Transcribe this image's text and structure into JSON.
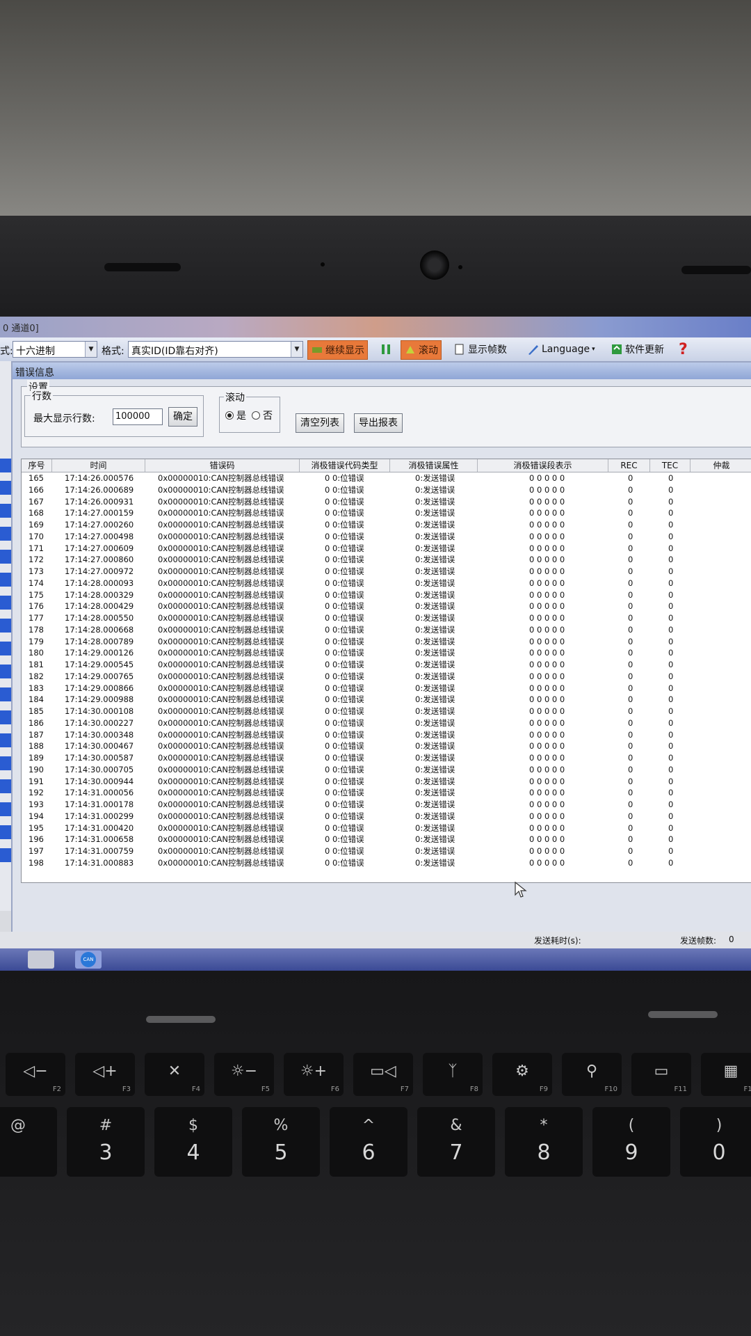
{
  "titlebar": {
    "text": "0 通道0]"
  },
  "toolbar": {
    "format_label": "式:",
    "hex_value": "十六进制",
    "format2_label": "格式:",
    "id_value": "真实ID(ID靠右对齐)",
    "continue_display": "继续显示",
    "auto": "滚动",
    "show_frames": "显示帧数",
    "language": "Language",
    "update": "软件更新"
  },
  "dialog": {
    "title": "错误信息",
    "settings_legend": "设置",
    "rows_legend": "行数",
    "max_rows_label": "最大显示行数:",
    "max_rows_value": "100000",
    "confirm_button": "确定",
    "scroll_legend": "滚动",
    "scroll_yes": "是",
    "scroll_no": "否",
    "scroll_selected": "yes",
    "clear_button": "清空列表",
    "export_button": "导出报表"
  },
  "table": {
    "headers": [
      "序号",
      "时间",
      "错误码",
      "消极错误代码类型",
      "消极错误属性",
      "消极错误段表示",
      "REC",
      "TEC",
      "仲裁"
    ],
    "rows": [
      {
        "no": "165",
        "time": "17:14:26.000576",
        "code": "0x00000010:CAN控制器总线错误",
        "type": "0 0:位错误",
        "attr": "0:发送错误",
        "seg": "0 0 0 0 0",
        "rec": "0",
        "tec": "0"
      },
      {
        "no": "166",
        "time": "17:14:26.000689",
        "code": "0x00000010:CAN控制器总线错误",
        "type": "0 0:位错误",
        "attr": "0:发送错误",
        "seg": "0 0 0 0 0",
        "rec": "0",
        "tec": "0"
      },
      {
        "no": "167",
        "time": "17:14:26.000931",
        "code": "0x00000010:CAN控制器总线错误",
        "type": "0 0:位错误",
        "attr": "0:发送错误",
        "seg": "0 0 0 0 0",
        "rec": "0",
        "tec": "0"
      },
      {
        "no": "168",
        "time": "17:14:27.000159",
        "code": "0x00000010:CAN控制器总线错误",
        "type": "0 0:位错误",
        "attr": "0:发送错误",
        "seg": "0 0 0 0 0",
        "rec": "0",
        "tec": "0"
      },
      {
        "no": "169",
        "time": "17:14:27.000260",
        "code": "0x00000010:CAN控制器总线错误",
        "type": "0 0:位错误",
        "attr": "0:发送错误",
        "seg": "0 0 0 0 0",
        "rec": "0",
        "tec": "0"
      },
      {
        "no": "170",
        "time": "17:14:27.000498",
        "code": "0x00000010:CAN控制器总线错误",
        "type": "0 0:位错误",
        "attr": "0:发送错误",
        "seg": "0 0 0 0 0",
        "rec": "0",
        "tec": "0"
      },
      {
        "no": "171",
        "time": "17:14:27.000609",
        "code": "0x00000010:CAN控制器总线错误",
        "type": "0 0:位错误",
        "attr": "0:发送错误",
        "seg": "0 0 0 0 0",
        "rec": "0",
        "tec": "0"
      },
      {
        "no": "172",
        "time": "17:14:27.000860",
        "code": "0x00000010:CAN控制器总线错误",
        "type": "0 0:位错误",
        "attr": "0:发送错误",
        "seg": "0 0 0 0 0",
        "rec": "0",
        "tec": "0"
      },
      {
        "no": "173",
        "time": "17:14:27.000972",
        "code": "0x00000010:CAN控制器总线错误",
        "type": "0 0:位错误",
        "attr": "0:发送错误",
        "seg": "0 0 0 0 0",
        "rec": "0",
        "tec": "0"
      },
      {
        "no": "174",
        "time": "17:14:28.000093",
        "code": "0x00000010:CAN控制器总线错误",
        "type": "0 0:位错误",
        "attr": "0:发送错误",
        "seg": "0 0 0 0 0",
        "rec": "0",
        "tec": "0"
      },
      {
        "no": "175",
        "time": "17:14:28.000329",
        "code": "0x00000010:CAN控制器总线错误",
        "type": "0 0:位错误",
        "attr": "0:发送错误",
        "seg": "0 0 0 0 0",
        "rec": "0",
        "tec": "0"
      },
      {
        "no": "176",
        "time": "17:14:28.000429",
        "code": "0x00000010:CAN控制器总线错误",
        "type": "0 0:位错误",
        "attr": "0:发送错误",
        "seg": "0 0 0 0 0",
        "rec": "0",
        "tec": "0"
      },
      {
        "no": "177",
        "time": "17:14:28.000550",
        "code": "0x00000010:CAN控制器总线错误",
        "type": "0 0:位错误",
        "attr": "0:发送错误",
        "seg": "0 0 0 0 0",
        "rec": "0",
        "tec": "0"
      },
      {
        "no": "178",
        "time": "17:14:28.000668",
        "code": "0x00000010:CAN控制器总线错误",
        "type": "0 0:位错误",
        "attr": "0:发送错误",
        "seg": "0 0 0 0 0",
        "rec": "0",
        "tec": "0"
      },
      {
        "no": "179",
        "time": "17:14:28.000789",
        "code": "0x00000010:CAN控制器总线错误",
        "type": "0 0:位错误",
        "attr": "0:发送错误",
        "seg": "0 0 0 0 0",
        "rec": "0",
        "tec": "0"
      },
      {
        "no": "180",
        "time": "17:14:29.000126",
        "code": "0x00000010:CAN控制器总线错误",
        "type": "0 0:位错误",
        "attr": "0:发送错误",
        "seg": "0 0 0 0 0",
        "rec": "0",
        "tec": "0"
      },
      {
        "no": "181",
        "time": "17:14:29.000545",
        "code": "0x00000010:CAN控制器总线错误",
        "type": "0 0:位错误",
        "attr": "0:发送错误",
        "seg": "0 0 0 0 0",
        "rec": "0",
        "tec": "0"
      },
      {
        "no": "182",
        "time": "17:14:29.000765",
        "code": "0x00000010:CAN控制器总线错误",
        "type": "0 0:位错误",
        "attr": "0:发送错误",
        "seg": "0 0 0 0 0",
        "rec": "0",
        "tec": "0"
      },
      {
        "no": "183",
        "time": "17:14:29.000866",
        "code": "0x00000010:CAN控制器总线错误",
        "type": "0 0:位错误",
        "attr": "0:发送错误",
        "seg": "0 0 0 0 0",
        "rec": "0",
        "tec": "0"
      },
      {
        "no": "184",
        "time": "17:14:29.000988",
        "code": "0x00000010:CAN控制器总线错误",
        "type": "0 0:位错误",
        "attr": "0:发送错误",
        "seg": "0 0 0 0 0",
        "rec": "0",
        "tec": "0"
      },
      {
        "no": "185",
        "time": "17:14:30.000108",
        "code": "0x00000010:CAN控制器总线错误",
        "type": "0 0:位错误",
        "attr": "0:发送错误",
        "seg": "0 0 0 0 0",
        "rec": "0",
        "tec": "0"
      },
      {
        "no": "186",
        "time": "17:14:30.000227",
        "code": "0x00000010:CAN控制器总线错误",
        "type": "0 0:位错误",
        "attr": "0:发送错误",
        "seg": "0 0 0 0 0",
        "rec": "0",
        "tec": "0"
      },
      {
        "no": "187",
        "time": "17:14:30.000348",
        "code": "0x00000010:CAN控制器总线错误",
        "type": "0 0:位错误",
        "attr": "0:发送错误",
        "seg": "0 0 0 0 0",
        "rec": "0",
        "tec": "0"
      },
      {
        "no": "188",
        "time": "17:14:30.000467",
        "code": "0x00000010:CAN控制器总线错误",
        "type": "0 0:位错误",
        "attr": "0:发送错误",
        "seg": "0 0 0 0 0",
        "rec": "0",
        "tec": "0"
      },
      {
        "no": "189",
        "time": "17:14:30.000587",
        "code": "0x00000010:CAN控制器总线错误",
        "type": "0 0:位错误",
        "attr": "0:发送错误",
        "seg": "0 0 0 0 0",
        "rec": "0",
        "tec": "0"
      },
      {
        "no": "190",
        "time": "17:14:30.000705",
        "code": "0x00000010:CAN控制器总线错误",
        "type": "0 0:位错误",
        "attr": "0:发送错误",
        "seg": "0 0 0 0 0",
        "rec": "0",
        "tec": "0"
      },
      {
        "no": "191",
        "time": "17:14:30.000944",
        "code": "0x00000010:CAN控制器总线错误",
        "type": "0 0:位错误",
        "attr": "0:发送错误",
        "seg": "0 0 0 0 0",
        "rec": "0",
        "tec": "0"
      },
      {
        "no": "192",
        "time": "17:14:31.000056",
        "code": "0x00000010:CAN控制器总线错误",
        "type": "0 0:位错误",
        "attr": "0:发送错误",
        "seg": "0 0 0 0 0",
        "rec": "0",
        "tec": "0"
      },
      {
        "no": "193",
        "time": "17:14:31.000178",
        "code": "0x00000010:CAN控制器总线错误",
        "type": "0 0:位错误",
        "attr": "0:发送错误",
        "seg": "0 0 0 0 0",
        "rec": "0",
        "tec": "0"
      },
      {
        "no": "194",
        "time": "17:14:31.000299",
        "code": "0x00000010:CAN控制器总线错误",
        "type": "0 0:位错误",
        "attr": "0:发送错误",
        "seg": "0 0 0 0 0",
        "rec": "0",
        "tec": "0"
      },
      {
        "no": "195",
        "time": "17:14:31.000420",
        "code": "0x00000010:CAN控制器总线错误",
        "type": "0 0:位错误",
        "attr": "0:发送错误",
        "seg": "0 0 0 0 0",
        "rec": "0",
        "tec": "0"
      },
      {
        "no": "196",
        "time": "17:14:31.000658",
        "code": "0x00000010:CAN控制器总线错误",
        "type": "0 0:位错误",
        "attr": "0:发送错误",
        "seg": "0 0 0 0 0",
        "rec": "0",
        "tec": "0"
      },
      {
        "no": "197",
        "time": "17:14:31.000759",
        "code": "0x00000010:CAN控制器总线错误",
        "type": "0 0:位错误",
        "attr": "0:发送错误",
        "seg": "0 0 0 0 0",
        "rec": "0",
        "tec": "0"
      },
      {
        "no": "198",
        "time": "17:14:31.000883",
        "code": "0x00000010:CAN控制器总线错误",
        "type": "0 0:位错误",
        "attr": "0:发送错误",
        "seg": "0 0 0 0 0",
        "rec": "0",
        "tec": "0"
      }
    ]
  },
  "statusbar": {
    "send_time": "发送耗时(s):",
    "send_frames": "发送帧数:",
    "send_frames_value": "0"
  },
  "taskbar": {
    "can_app": "CAN"
  },
  "keyboard": {
    "fkeys": [
      {
        "icon": "volume-down-icon",
        "glyph": "◁−",
        "label": "F2"
      },
      {
        "icon": "volume-up-icon",
        "glyph": "◁+",
        "label": "F3"
      },
      {
        "icon": "close-icon",
        "glyph": "✕",
        "label": "F4"
      },
      {
        "icon": "brightness-down-icon",
        "glyph": "☼−",
        "label": "F5"
      },
      {
        "icon": "brightness-up-icon",
        "glyph": "☼+",
        "label": "F6"
      },
      {
        "icon": "projector-icon",
        "glyph": "▭◁",
        "label": "F7"
      },
      {
        "icon": "wifi-icon",
        "glyph": "ᛉ",
        "label": "F8"
      },
      {
        "icon": "settings-icon",
        "glyph": "⚙",
        "label": "F9"
      },
      {
        "icon": "search-icon",
        "glyph": "⚲",
        "label": "F10"
      },
      {
        "icon": "keyboard-icon",
        "glyph": "▭",
        "label": "F11"
      },
      {
        "icon": "apps-icon",
        "glyph": "▦",
        "label": "F12"
      }
    ],
    "numkeys": [
      {
        "sym": "@",
        "num": ""
      },
      {
        "sym": "#",
        "num": "3"
      },
      {
        "sym": "$",
        "num": "4"
      },
      {
        "sym": "%",
        "num": "5"
      },
      {
        "sym": "^",
        "num": "6"
      },
      {
        "sym": "&",
        "num": "7"
      },
      {
        "sym": "*",
        "num": "8"
      },
      {
        "sym": "(",
        "num": "9"
      },
      {
        "sym": ")",
        "num": "0"
      }
    ]
  },
  "colors": {
    "accent_orange": "#e8793a",
    "selection_blue": "#2a5cd2",
    "titlebar_blue": "#8fa6d6"
  }
}
